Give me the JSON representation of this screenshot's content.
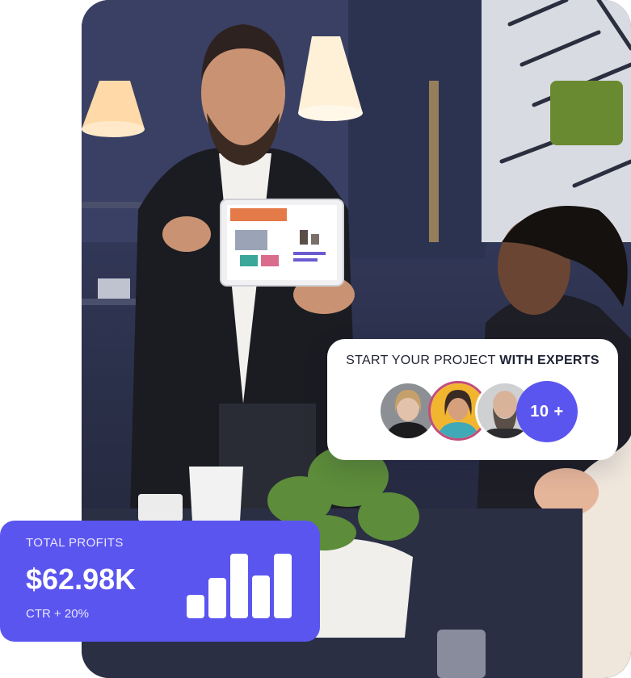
{
  "experts": {
    "title_regular": "START YOUR PROJECT ",
    "title_bold": "WITH EXPERTS",
    "more_label": "10 +"
  },
  "profits": {
    "label": "TOTAL PROFITS",
    "value": "$62.98K",
    "ctr": "CTR + 20%",
    "bar_levels": [
      0.36,
      0.62,
      1.0,
      0.66,
      1.0
    ]
  },
  "colors": {
    "accent": "#5b55f0",
    "card": "#ffffff"
  }
}
